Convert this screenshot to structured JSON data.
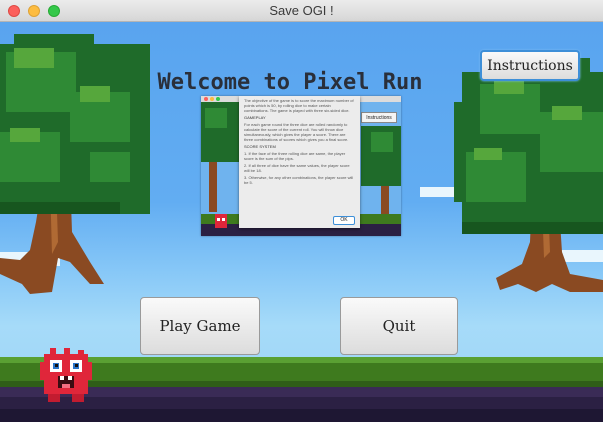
{
  "window": {
    "title": "Save OGI !"
  },
  "main": {
    "heading": "Welcome to Pixel Run",
    "play_button": "Play Game",
    "quit_button": "Quit",
    "instructions_button": "Instructions"
  },
  "popup": {
    "instructions_button": "Instructions",
    "intro": "The objective of the game is to score the maximum number of points which is 50, by rolling dice to make certain combinations. The game is played with three six-sided dice.",
    "gameplay_heading": "GAMEPLAY",
    "gameplay_text": "For each game round the three dice are rolled randomly to calculate the score of the current roll. You will throw dice simultaneously, which gives the player a score. There are three combinations of scores which gives you a final score.",
    "score_heading": "SCORE SYSTEM",
    "score_1": "1. If the face of the three rolling dice are same, the player score is the sum of the pips.",
    "score_2": "2. If all three of dice have the same values, the player score will be 18.",
    "score_3": "3. Otherwise, for any other combinations, the player score will be 5.",
    "ok_button": "OK"
  },
  "colors": {
    "sky_top": "#59a4ef",
    "leaf_dark": "#1f6b2a",
    "leaf": "#2f8a35",
    "leaf_light": "#56a73c",
    "trunk": "#8a4a22",
    "grass": "#3e7a1e",
    "soil": "#2b2043",
    "mascot": "#e0263a"
  },
  "icons": [
    "close-icon",
    "minimize-icon",
    "maximize-icon",
    "mascot-icon"
  ]
}
